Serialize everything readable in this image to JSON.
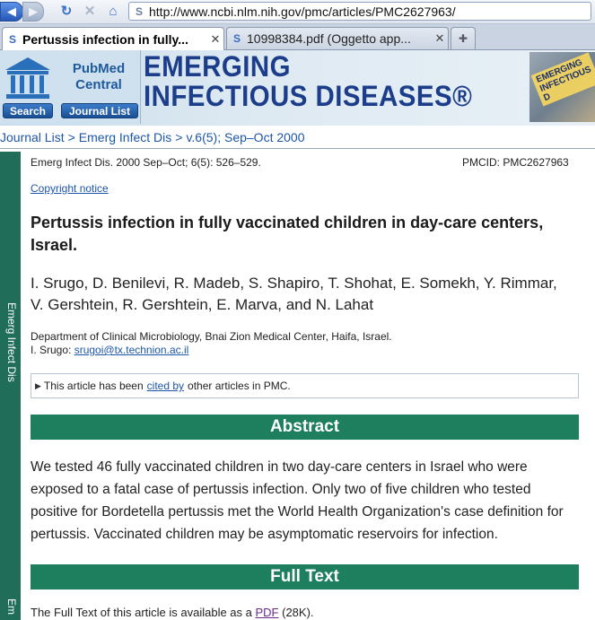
{
  "browser": {
    "url": "http://www.ncbi.nlm.nih.gov/pmc/articles/PMC2627963/",
    "tabs": [
      {
        "label": "Pertussis infection in fully...",
        "active": true
      },
      {
        "label": "10998384.pdf (Oggetto app...",
        "active": false
      }
    ]
  },
  "banner": {
    "pmc_line1": "PubMed",
    "pmc_line2": "Central",
    "search_label": "Search",
    "journal_list_label": "Journal List",
    "journal_line1": "EMERGING",
    "journal_line2": "INFECTIOUS DISEASES®",
    "cover_text_1": "EMERGING",
    "cover_text_2": "INFECTIOUS D"
  },
  "breadcrumb": [
    "Journal List",
    "Emerg Infect Dis",
    "v.6(5); Sep–Oct 2000"
  ],
  "sidebar": {
    "label_1": "Emerg Infect Dis",
    "label_2": "Em"
  },
  "article": {
    "citation": "Emerg Infect Dis. 2000 Sep–Oct; 6(5): 526–529.",
    "pmcid": "PMCID: PMC2627963",
    "copyright": "Copyright notice",
    "title": "Pertussis infection in fully vaccinated children in day-care centers, Israel.",
    "authors": "I. Srugo, D. Benilevi, R. Madeb, S. Shapiro, T. Shohat, E. Somekh, Y. Rimmar, V. Gershtein, R. Gershtein, E. Marva, and N. Lahat",
    "affiliation": "Department of Clinical Microbiology, Bnai Zion Medical Center, Haifa, Israel.",
    "contact_prefix": "I. Srugo: ",
    "contact_email": "srugoi@tx.technion.ac.il",
    "cited_prefix": "This article has been",
    "cited_link": "cited by",
    "cited_suffix": "other articles in PMC.",
    "abstract_heading": "Abstract",
    "abstract_text": "We tested 46 fully vaccinated children in two day-care centers in Israel who were exposed to a fatal case of pertussis infection. Only two of five children who tested positive for Bordetella pertussis met the World Health Organization's case definition for pertussis. Vaccinated children may be asymptomatic reservoirs for infection.",
    "fulltext_heading": "Full Text",
    "fulltext_prefix": "The Full Text of this article is available as a",
    "fulltext_link": "PDF",
    "fulltext_size": "(28K)."
  },
  "colors": {
    "section_green": "#1e7f5e",
    "link_blue": "#1d56a8",
    "sidebar_green": "#206d5a"
  }
}
